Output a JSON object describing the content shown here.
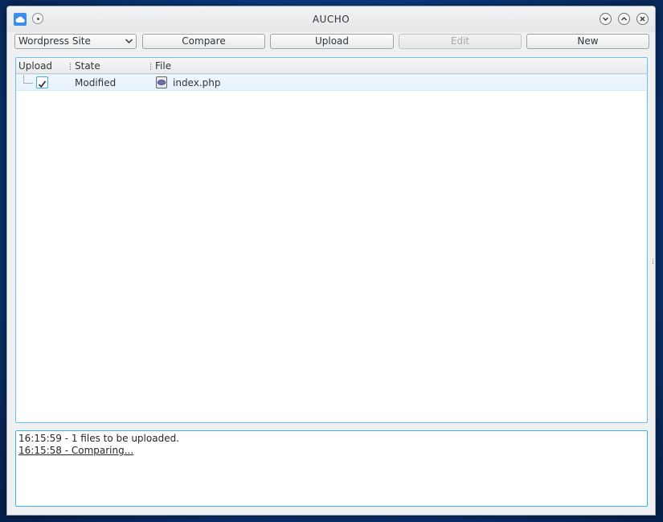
{
  "window": {
    "title": "AUCHO"
  },
  "toolbar": {
    "site_select": {
      "value": "Wordpress Site"
    },
    "compare_label": "Compare",
    "upload_label": "Upload",
    "edit_label": "Edit",
    "new_label": "New"
  },
  "file_tree": {
    "columns": [
      "Upload",
      "State",
      "File"
    ],
    "rows": [
      {
        "upload_checked": true,
        "state": "Modified",
        "file": "index.php",
        "file_icon": "php-file-icon"
      }
    ]
  },
  "log": {
    "lines": [
      "16:15:59 - 1 files to be uploaded.",
      "16:15:58 - Comparing..."
    ]
  },
  "colors": {
    "accent": "#3daee9",
    "window_bg": "#eff0f1",
    "selection_row": "#e5f1fb",
    "text": "#31363b"
  }
}
